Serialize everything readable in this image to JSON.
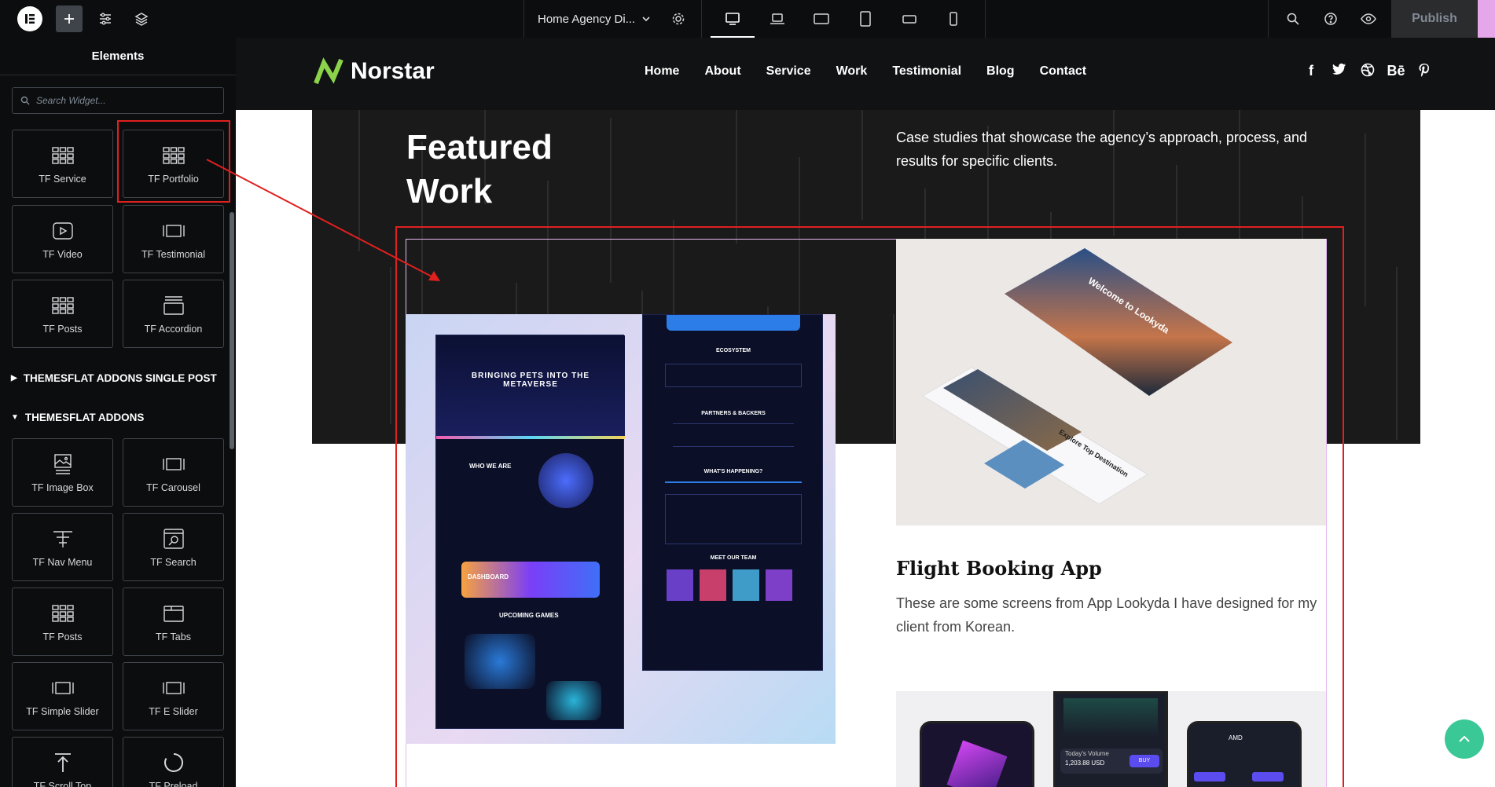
{
  "topbar": {
    "document_title": "Home Agency Di...",
    "publish_label": "Publish",
    "icons": [
      "elementor-logo-icon",
      "plus-icon",
      "sliders-icon",
      "layers-icon",
      "chevron-down-icon",
      "gear-icon",
      "desktop-icon",
      "laptop-icon",
      "tablet-landscape-icon",
      "tablet-portrait-icon",
      "mobile-landscape-icon",
      "mobile-portrait-icon",
      "search-icon",
      "help-icon",
      "eye-icon"
    ]
  },
  "panel": {
    "header": "Elements",
    "search_placeholder": "Search Widget...",
    "widgets_top": [
      {
        "label": "TF Service",
        "icon": "grid-icon"
      },
      {
        "label": "TF Portfolio",
        "icon": "grid-icon"
      },
      {
        "label": "TF Video",
        "icon": "video-icon"
      },
      {
        "label": "TF Testimonial",
        "icon": "slides-icon"
      },
      {
        "label": "TF Posts",
        "icon": "grid-icon"
      },
      {
        "label": "TF Accordion",
        "icon": "accordion-icon"
      }
    ],
    "section_single_post": "THEMESFLAT ADDONS SINGLE POST",
    "section_addons": "THEMESFLAT ADDONS",
    "widgets_addons": [
      {
        "label": "TF Image Box",
        "icon": "image-box-icon"
      },
      {
        "label": "TF Carousel",
        "icon": "slides-icon"
      },
      {
        "label": "TF Nav Menu",
        "icon": "nav-menu-icon"
      },
      {
        "label": "TF Search",
        "icon": "search-form-icon"
      },
      {
        "label": "TF Posts",
        "icon": "grid-icon"
      },
      {
        "label": "TF Tabs",
        "icon": "tabs-icon"
      },
      {
        "label": "TF Simple Slider",
        "icon": "slides-icon"
      },
      {
        "label": "TF E Slider",
        "icon": "slides-icon"
      },
      {
        "label": "TF Scroll Top",
        "icon": "scroll-top-icon"
      },
      {
        "label": "TF Preload",
        "icon": "preload-icon"
      }
    ]
  },
  "site": {
    "brand": "Norstar",
    "nav": [
      "Home",
      "About",
      "Service",
      "Work",
      "Testimonial",
      "Blog",
      "Contact"
    ],
    "social": [
      "f",
      "t",
      "d",
      "Bē",
      "p"
    ],
    "featured_title": "Featured Work",
    "featured_desc": "Case studies that showcase the agency’s approach, process, and results for specific clients.",
    "card2_title": "Flight Booking App",
    "card2_desc": "These are some screens from App Lookyda I have designed for my client from Korean.",
    "card1_screen_texts": [
      "BRINGING PETS INTO THE METAVERSE",
      "WHO WE ARE",
      "DASHBOARD",
      "UPCOMING GAMES",
      "ECOSYSTEM",
      "PARTNERS & BACKERS",
      "WHAT'S HAPPENING?",
      "MEET OUR TEAM"
    ],
    "card2_screen_texts": [
      "Welcome to Lookyda",
      "Explore Top Destination"
    ],
    "card3_screen_texts": [
      "Today's Volume",
      "1,203.88 USD",
      "BUY",
      "AMD"
    ]
  },
  "colors": {
    "accent_red": "#e0201f",
    "brand_green": "#8bd44a",
    "scroll_top": "#3bc897",
    "publish_bg": "#2b2c2e"
  }
}
